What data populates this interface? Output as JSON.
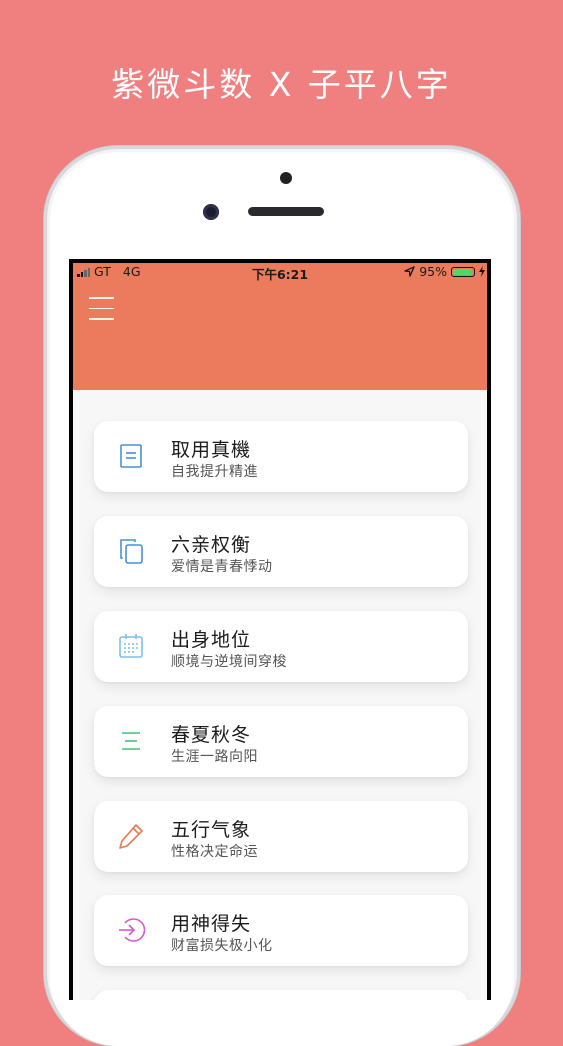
{
  "headline": "紫微斗数 X 子平八字",
  "status_bar": {
    "carrier": "GT",
    "network": "4G",
    "time": "下午6:21",
    "battery": "95%"
  },
  "colors": {
    "background": "#f08080",
    "header": "#ec7a5c"
  },
  "menu": [
    {
      "title": "取用真機",
      "subtitle": "自我提升精進",
      "icon": "document-icon",
      "color": "#4a90d9"
    },
    {
      "title": "六亲权衡",
      "subtitle": "爱情是青春悸动",
      "icon": "copy-icon",
      "color": "#4a90d9"
    },
    {
      "title": "出身地位",
      "subtitle": "顺境与逆境间穿梭",
      "icon": "calendar-icon",
      "color": "#7cc0e8"
    },
    {
      "title": "春夏秋冬",
      "subtitle": "生涯一路向阳",
      "icon": "list-icon",
      "color": "#3cc47a"
    },
    {
      "title": "五行气象",
      "subtitle": "性格决定命运",
      "icon": "pencil-icon",
      "color": "#e8794f"
    },
    {
      "title": "用神得失",
      "subtitle": "财富损失极小化",
      "icon": "sign-in-icon",
      "color": "#d65ad0"
    }
  ]
}
